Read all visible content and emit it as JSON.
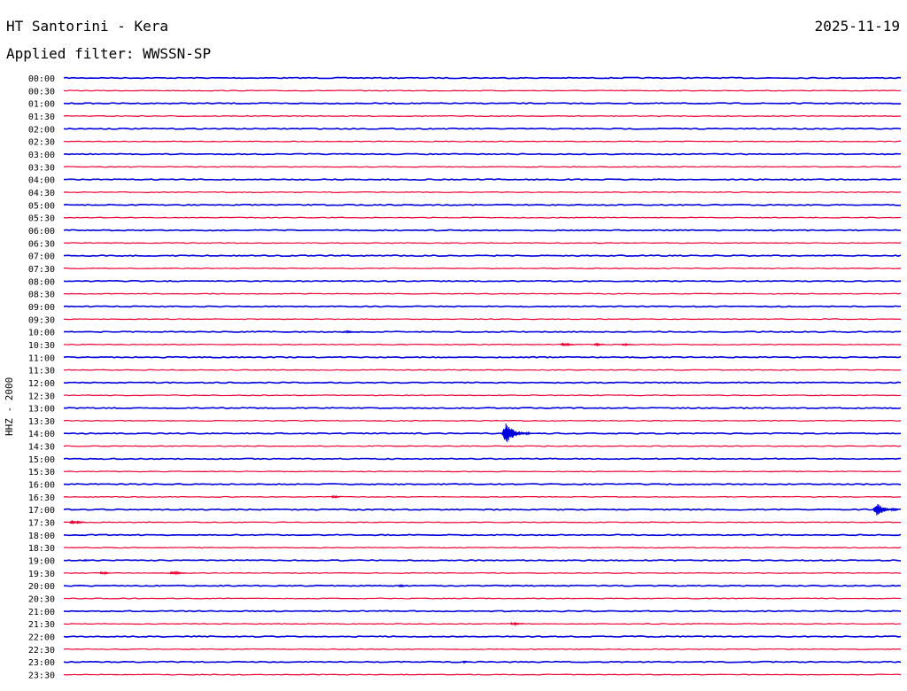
{
  "header": {
    "title": "HT Santorini - Kera",
    "date": "2025-11-19",
    "filter": "Applied filter: WWSSN-SP",
    "channel": "HHZ - 2000"
  },
  "colors": {
    "blue": "#0000dd",
    "red": "#ee0033"
  },
  "chart_data": {
    "type": "line",
    "title": "HT Santorini - Kera",
    "subtitle": "Applied filter: WWSSN-SP",
    "ylabel": "HHZ - 2000",
    "row_labels": [
      "00:00",
      "00:30",
      "01:00",
      "01:30",
      "02:00",
      "02:30",
      "03:00",
      "03:30",
      "04:00",
      "04:30",
      "05:00",
      "05:30",
      "06:00",
      "06:30",
      "07:00",
      "07:30",
      "08:00",
      "08:30",
      "09:00",
      "09:30",
      "10:00",
      "10:30",
      "11:00",
      "11:30",
      "12:00",
      "12:30",
      "13:00",
      "13:30",
      "14:00",
      "14:30",
      "15:00",
      "15:30",
      "16:00",
      "16:30",
      "17:00",
      "17:30",
      "18:00",
      "18:30",
      "19:00",
      "19:30",
      "20:00",
      "20:30",
      "21:00",
      "21:30",
      "22:00",
      "22:30",
      "23:00",
      "23:30"
    ],
    "row_colors": [
      "blue",
      "red"
    ],
    "x_range_minutes": [
      0,
      30
    ],
    "events": [
      {
        "row": "10:00",
        "at_minute": 10.0,
        "amplitude": 1.2,
        "duration_minutes": 0.6
      },
      {
        "row": "10:30",
        "at_minute": 17.8,
        "amplitude": 2.5,
        "duration_minutes": 0.5
      },
      {
        "row": "10:30",
        "at_minute": 19.0,
        "amplitude": 1.4,
        "duration_minutes": 0.4
      },
      {
        "row": "10:30",
        "at_minute": 20.0,
        "amplitude": 1.4,
        "duration_minutes": 0.4
      },
      {
        "row": "14:00",
        "at_minute": 15.7,
        "amplitude": 12,
        "duration_minutes": 1.0
      },
      {
        "row": "16:30",
        "at_minute": 9.6,
        "amplitude": 2.5,
        "duration_minutes": 0.3
      },
      {
        "row": "17:00",
        "at_minute": 29.0,
        "amplitude": 8,
        "duration_minutes": 0.9
      },
      {
        "row": "17:30",
        "at_minute": 0.2,
        "amplitude": 2.5,
        "duration_minutes": 0.6
      },
      {
        "row": "19:00",
        "at_minute": 0.7,
        "amplitude": 1.2,
        "duration_minutes": 0.2
      },
      {
        "row": "19:30",
        "at_minute": 1.3,
        "amplitude": 2,
        "duration_minutes": 0.4
      },
      {
        "row": "19:30",
        "at_minute": 3.8,
        "amplitude": 2,
        "duration_minutes": 0.6
      },
      {
        "row": "20:00",
        "at_minute": 12.0,
        "amplitude": 1.5,
        "duration_minutes": 0.3
      },
      {
        "row": "21:30",
        "at_minute": 16.0,
        "amplitude": 1.5,
        "duration_minutes": 0.5
      },
      {
        "row": "23:00",
        "at_minute": 14.3,
        "amplitude": 1.2,
        "duration_minutes": 0.2
      }
    ]
  }
}
